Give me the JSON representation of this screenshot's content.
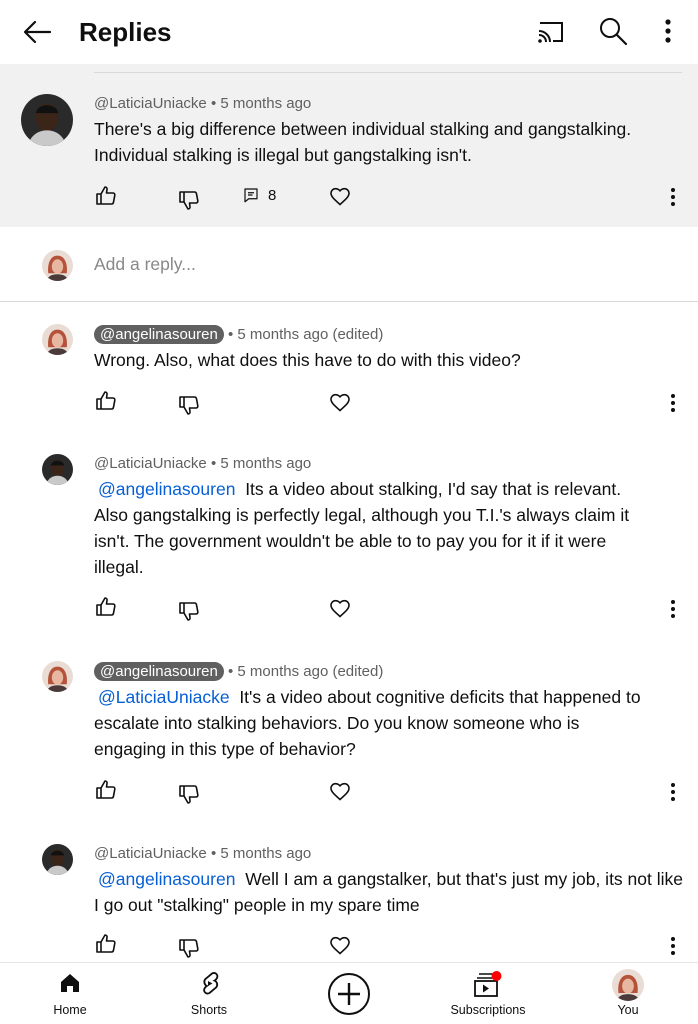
{
  "header": {
    "title": "Replies",
    "icons": [
      "back-arrow-icon",
      "cast-icon",
      "search-icon",
      "more-vert-icon"
    ]
  },
  "parent_comment": {
    "author": "@LaticiaUniacke",
    "time": "• 5 months ago",
    "text": "There's a big difference between individual stalking and gangstalking. Individual stalking is illegal but gangstalking isn't.",
    "reply_count": "8"
  },
  "add_reply": {
    "placeholder": "Add a reply..."
  },
  "replies": [
    {
      "author": "@angelinasouren",
      "author_is_creator": true,
      "time": "• 5 months ago (edited)",
      "mention": "",
      "text": "Wrong. Also, what does this have to do with this video?"
    },
    {
      "author": "@LaticiaUniacke",
      "author_is_creator": false,
      "time": "• 5 months ago",
      "mention": "@angelinasouren",
      "text": "Its a video about stalking, I'd say that is relevant. Also gangstalking is perfectly legal, although you T.I.'s always claim it isn't. The government wouldn't be able to to pay you for it if it were illegal."
    },
    {
      "author": "@angelinasouren",
      "author_is_creator": true,
      "time": "• 5 months ago (edited)",
      "mention": "@LaticiaUniacke",
      "text": "It's a video about cognitive deficits that happened to escalate into stalking behaviors. Do you know someone who is engaging in this type of behavior?"
    },
    {
      "author": "@LaticiaUniacke",
      "author_is_creator": false,
      "time": "• 5 months ago",
      "mention": "@angelinasouren",
      "text": "Well I am a gangstalker, but that's just my job, its not like I go out \"stalking\" people in my spare time"
    }
  ],
  "bottom_nav": {
    "home": "Home",
    "shorts": "Shorts",
    "subscriptions": "Subscriptions",
    "you": "You"
  },
  "colors": {
    "mention": "#065fd4",
    "creator_chip": "#606060",
    "parent_bg": "#f1f1f1",
    "notification_dot": "#ff0000"
  }
}
